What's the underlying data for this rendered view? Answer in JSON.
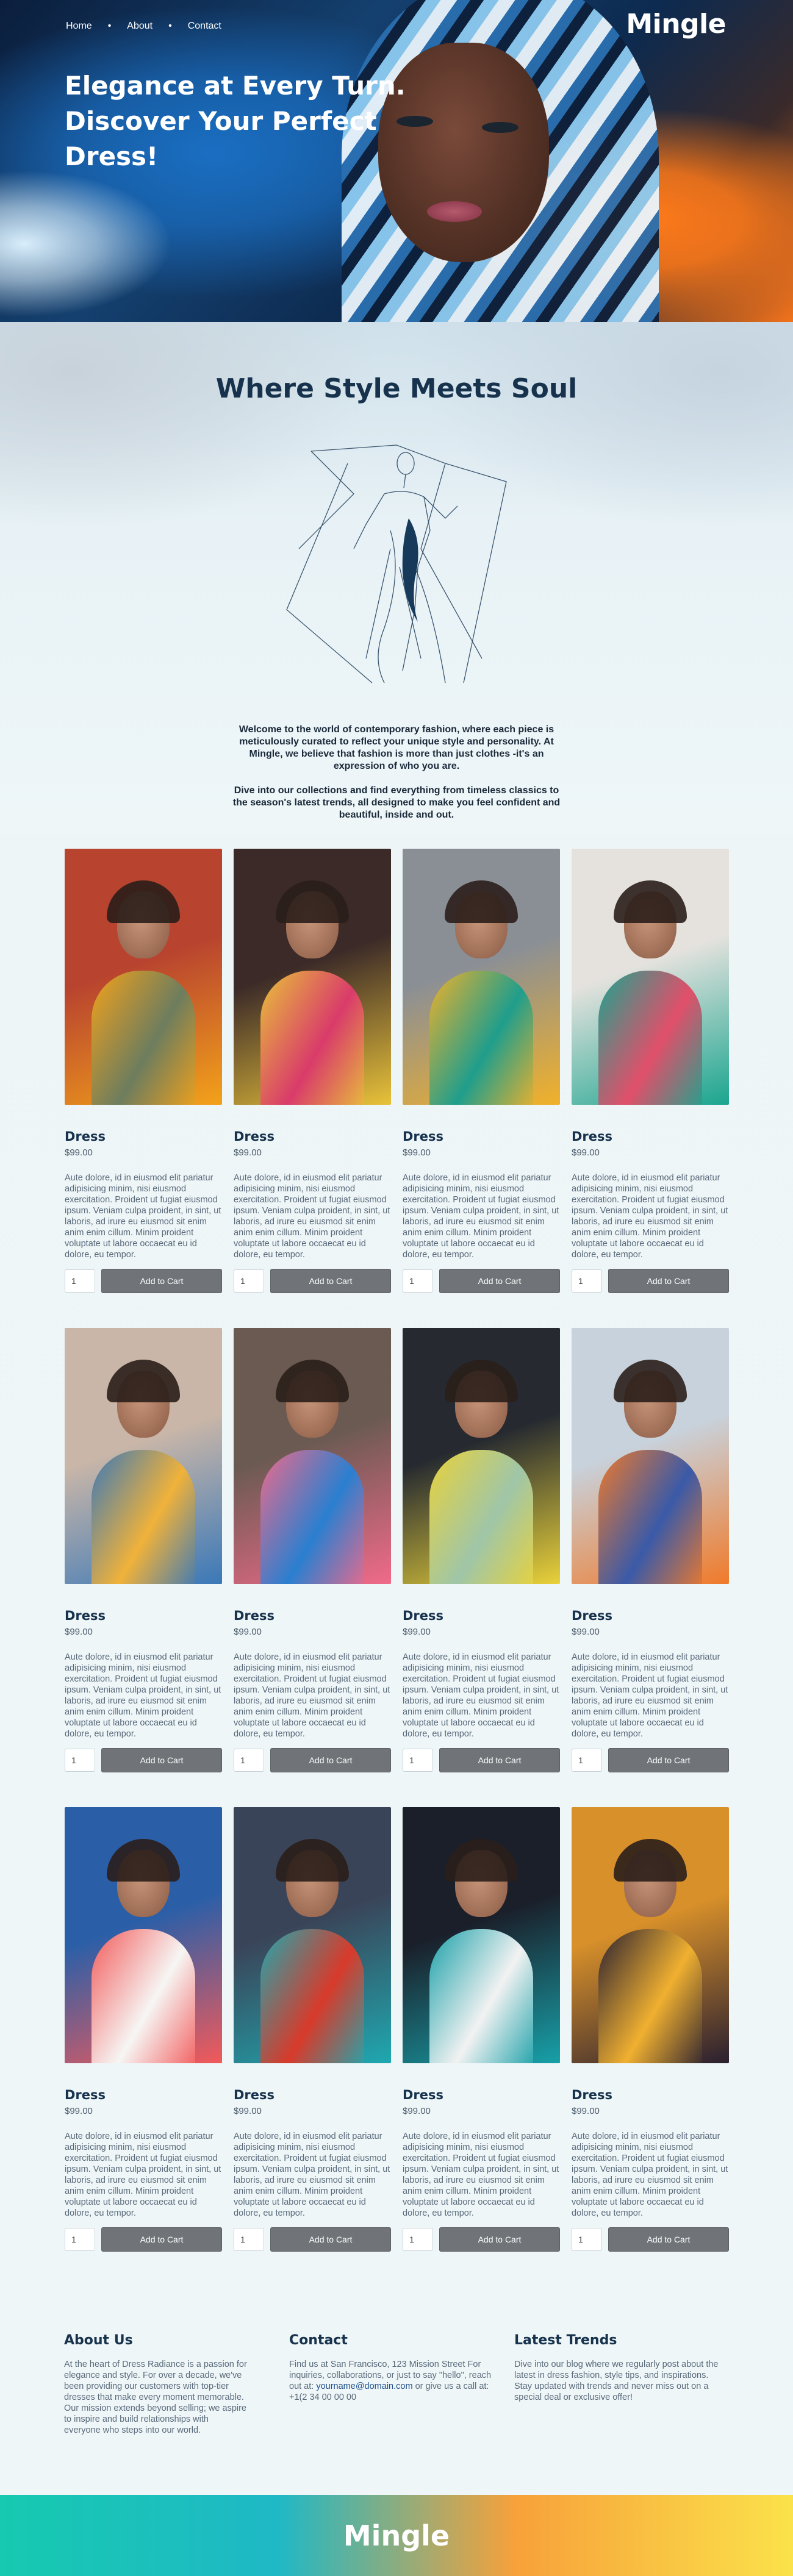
{
  "nav": {
    "items": [
      {
        "label": "Home"
      },
      {
        "label": "About"
      },
      {
        "label": "Contact"
      }
    ],
    "logo": "Mingle"
  },
  "hero": {
    "title": "Elegance at Every Turn. Discover Your Perfect Dress!"
  },
  "section": {
    "title": "Where Style Meets Soul",
    "intro_1": "Welcome to the world of contemporary fashion, where each piece is meticulously curated to reflect your unique style and personality. At Mingle, we believe that fashion is more than just clothes -it's an expression of who you are.",
    "intro_2": "Dive into our collections and find everything from timeless classics to the season's latest trends, all designed to make you feel confident and beautiful, inside and out."
  },
  "product": {
    "name": "Dress",
    "price": "$99.00",
    "description": "Aute dolore, id in eiusmod elit pariatur adipisicing minim, nisi eiusmod exercitation. Proident ut fugiat eiusmod ipsum. Veniam culpa proident, in sint, ut laboris, ad irure eu eiusmod sit enim anim enim cillum. Minim proident voluptate ut labore occaecat eu id dolore, eu tempor.",
    "qty": "1",
    "add_label": "Add to Cart"
  },
  "footer": {
    "about_title": "About Us",
    "about_text": "At the heart of Dress Radiance is a passion for elegance and style. For over a decade, we've been providing our customers with top-tier dresses that make every moment memorable. Our mission extends beyond selling; we aspire to inspire and build relationships with everyone who steps into our world.",
    "contact_title": "Contact",
    "contact_text_1": "Find us at San Francisco, 123 Mission Street For inquiries, collaborations, or just to say \"hello\", reach out at:",
    "contact_email": "yourname@domain.com",
    "contact_text_2": "or give us a call at: +1(2 34 00 00 00",
    "trends_title": "Latest Trends",
    "trends_text": "Dive into our blog where we regularly post about the latest in dress fashion, style tips, and inspirations. Stay updated with trends and never miss out on a special deal or exclusive offer!",
    "logo": "Mingle"
  }
}
